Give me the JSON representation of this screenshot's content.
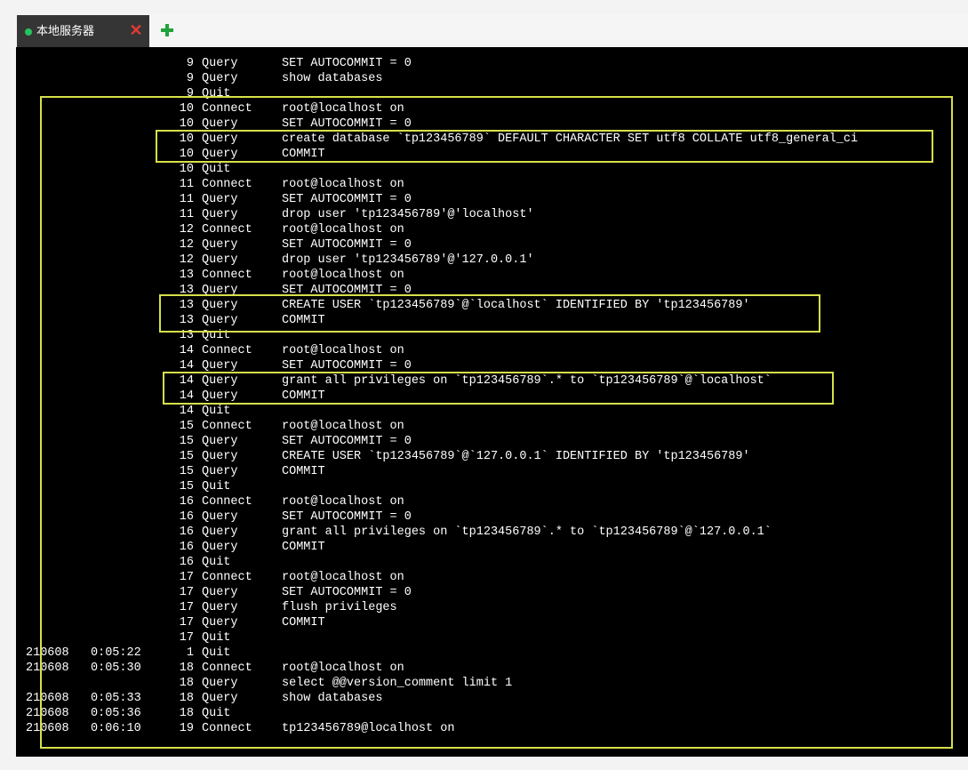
{
  "tabs": [
    {
      "label": "本地服务器",
      "status_color": "#22c55e",
      "close_glyph": "✕"
    }
  ],
  "add_tab_label": "+",
  "highlight_color": "#d6e04a",
  "log_lines": [
    {
      "date": "",
      "time": "",
      "id": "9",
      "cmd": "Query",
      "arg": "SET AUTOCOMMIT = 0"
    },
    {
      "date": "",
      "time": "",
      "id": "9",
      "cmd": "Query",
      "arg": "show databases"
    },
    {
      "date": "",
      "time": "",
      "id": "9",
      "cmd": "Quit",
      "arg": ""
    },
    {
      "date": "",
      "time": "",
      "id": "10",
      "cmd": "Connect",
      "arg": "root@localhost on"
    },
    {
      "date": "",
      "time": "",
      "id": "10",
      "cmd": "Query",
      "arg": "SET AUTOCOMMIT = 0"
    },
    {
      "date": "",
      "time": "",
      "id": "10",
      "cmd": "Query",
      "arg": "create database `tp123456789` DEFAULT CHARACTER SET utf8 COLLATE utf8_general_ci"
    },
    {
      "date": "",
      "time": "",
      "id": "10",
      "cmd": "Query",
      "arg": "COMMIT"
    },
    {
      "date": "",
      "time": "",
      "id": "10",
      "cmd": "Quit",
      "arg": ""
    },
    {
      "date": "",
      "time": "",
      "id": "11",
      "cmd": "Connect",
      "arg": "root@localhost on"
    },
    {
      "date": "",
      "time": "",
      "id": "11",
      "cmd": "Query",
      "arg": "SET AUTOCOMMIT = 0"
    },
    {
      "date": "",
      "time": "",
      "id": "11",
      "cmd": "Query",
      "arg": "drop user 'tp123456789'@'localhost'"
    },
    {
      "date": "",
      "time": "",
      "id": "12",
      "cmd": "Connect",
      "arg": "root@localhost on"
    },
    {
      "date": "",
      "time": "",
      "id": "12",
      "cmd": "Query",
      "arg": "SET AUTOCOMMIT = 0"
    },
    {
      "date": "",
      "time": "",
      "id": "12",
      "cmd": "Query",
      "arg": "drop user 'tp123456789'@'127.0.0.1'"
    },
    {
      "date": "",
      "time": "",
      "id": "13",
      "cmd": "Connect",
      "arg": "root@localhost on"
    },
    {
      "date": "",
      "time": "",
      "id": "13",
      "cmd": "Query",
      "arg": "SET AUTOCOMMIT = 0"
    },
    {
      "date": "",
      "time": "",
      "id": "13",
      "cmd": "Query",
      "arg": "CREATE USER `tp123456789`@`localhost` IDENTIFIED BY 'tp123456789'"
    },
    {
      "date": "",
      "time": "",
      "id": "13",
      "cmd": "Query",
      "arg": "COMMIT"
    },
    {
      "date": "",
      "time": "",
      "id": "13",
      "cmd": "Quit",
      "arg": ""
    },
    {
      "date": "",
      "time": "",
      "id": "14",
      "cmd": "Connect",
      "arg": "root@localhost on"
    },
    {
      "date": "",
      "time": "",
      "id": "14",
      "cmd": "Query",
      "arg": "SET AUTOCOMMIT = 0"
    },
    {
      "date": "",
      "time": "",
      "id": "14",
      "cmd": "Query",
      "arg": "grant all privileges on `tp123456789`.* to `tp123456789`@`localhost`"
    },
    {
      "date": "",
      "time": "",
      "id": "14",
      "cmd": "Query",
      "arg": "COMMIT"
    },
    {
      "date": "",
      "time": "",
      "id": "14",
      "cmd": "Quit",
      "arg": ""
    },
    {
      "date": "",
      "time": "",
      "id": "15",
      "cmd": "Connect",
      "arg": "root@localhost on"
    },
    {
      "date": "",
      "time": "",
      "id": "15",
      "cmd": "Query",
      "arg": "SET AUTOCOMMIT = 0"
    },
    {
      "date": "",
      "time": "",
      "id": "15",
      "cmd": "Query",
      "arg": "CREATE USER `tp123456789`@`127.0.0.1` IDENTIFIED BY 'tp123456789'"
    },
    {
      "date": "",
      "time": "",
      "id": "15",
      "cmd": "Query",
      "arg": "COMMIT"
    },
    {
      "date": "",
      "time": "",
      "id": "15",
      "cmd": "Quit",
      "arg": ""
    },
    {
      "date": "",
      "time": "",
      "id": "16",
      "cmd": "Connect",
      "arg": "root@localhost on"
    },
    {
      "date": "",
      "time": "",
      "id": "16",
      "cmd": "Query",
      "arg": "SET AUTOCOMMIT = 0"
    },
    {
      "date": "",
      "time": "",
      "id": "16",
      "cmd": "Query",
      "arg": "grant all privileges on `tp123456789`.* to `tp123456789`@`127.0.0.1`"
    },
    {
      "date": "",
      "time": "",
      "id": "16",
      "cmd": "Query",
      "arg": "COMMIT"
    },
    {
      "date": "",
      "time": "",
      "id": "16",
      "cmd": "Quit",
      "arg": ""
    },
    {
      "date": "",
      "time": "",
      "id": "17",
      "cmd": "Connect",
      "arg": "root@localhost on"
    },
    {
      "date": "",
      "time": "",
      "id": "17",
      "cmd": "Query",
      "arg": "SET AUTOCOMMIT = 0"
    },
    {
      "date": "",
      "time": "",
      "id": "17",
      "cmd": "Query",
      "arg": "flush privileges"
    },
    {
      "date": "",
      "time": "",
      "id": "17",
      "cmd": "Query",
      "arg": "COMMIT"
    },
    {
      "date": "",
      "time": "",
      "id": "17",
      "cmd": "Quit",
      "arg": ""
    },
    {
      "date": "210608",
      "time": "0:05:22",
      "id": "1",
      "cmd": "Quit",
      "arg": ""
    },
    {
      "date": "210608",
      "time": "0:05:30",
      "id": "18",
      "cmd": "Connect",
      "arg": "root@localhost on"
    },
    {
      "date": "",
      "time": "",
      "id": "18",
      "cmd": "Query",
      "arg": "select @@version_comment limit 1"
    },
    {
      "date": "210608",
      "time": "0:05:33",
      "id": "18",
      "cmd": "Query",
      "arg": "show databases"
    },
    {
      "date": "210608",
      "time": "0:05:36",
      "id": "18",
      "cmd": "Quit",
      "arg": ""
    },
    {
      "date": "210608",
      "time": "0:06:10",
      "id": "19",
      "cmd": "Connect",
      "arg": "tp123456789@localhost on"
    }
  ]
}
